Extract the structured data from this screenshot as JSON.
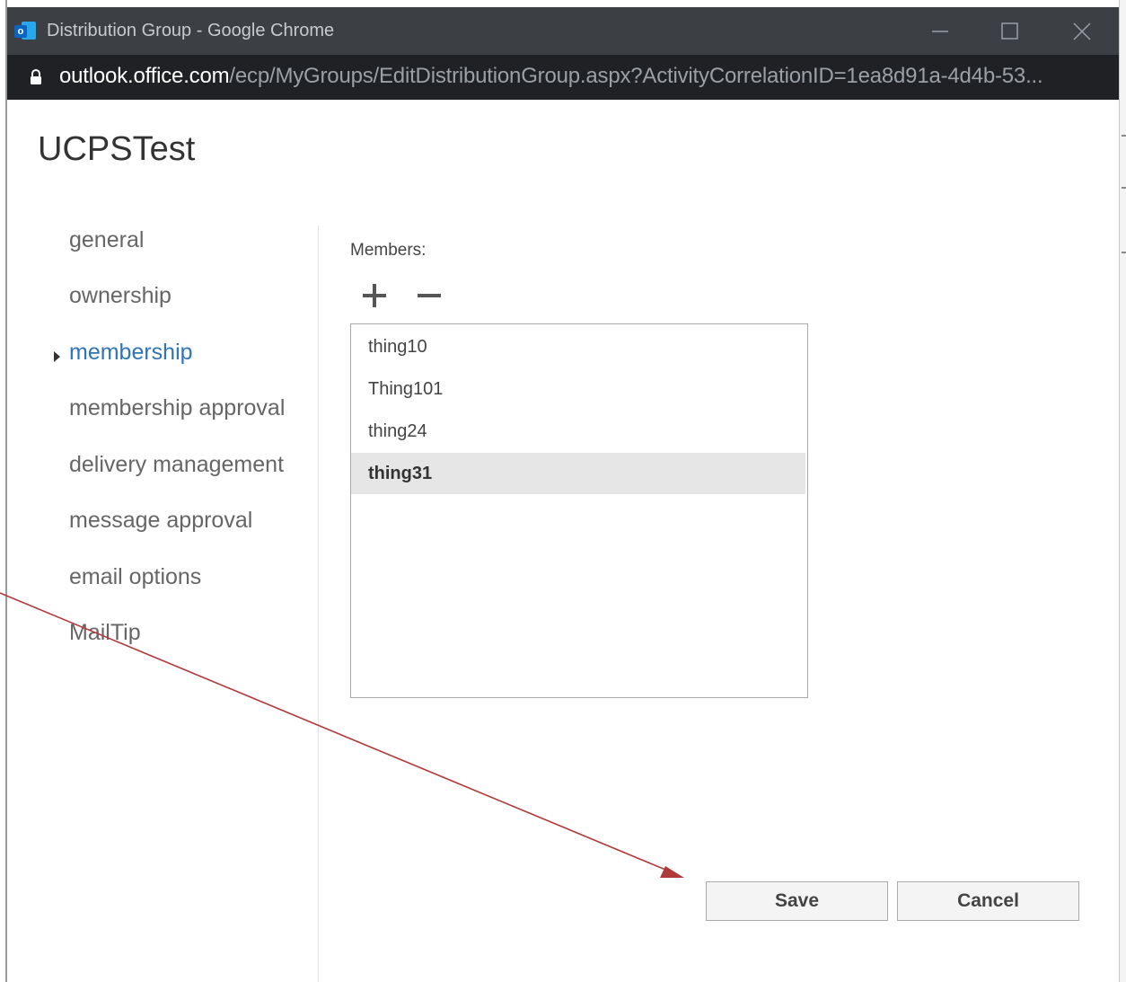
{
  "window": {
    "title": "Distribution Group - Google Chrome",
    "url_host": "outlook.office.com",
    "url_path": "/ecp/MyGroups/EditDistributionGroup.aspx?ActivityCorrelationID=1ea8d91a-4d4b-53..."
  },
  "page": {
    "title": "UCPSTest"
  },
  "nav": {
    "items": [
      {
        "label": "general"
      },
      {
        "label": "ownership"
      },
      {
        "label": "membership"
      },
      {
        "label": "membership approval"
      },
      {
        "label": "delivery management"
      },
      {
        "label": "message approval"
      },
      {
        "label": "email options"
      },
      {
        "label": "MailTip"
      }
    ],
    "selected": "membership"
  },
  "members": {
    "label": "Members:",
    "add_icon": "plus-icon",
    "remove_icon": "minus-icon",
    "list": [
      {
        "name": "thing10"
      },
      {
        "name": "Thing101"
      },
      {
        "name": "thing24"
      },
      {
        "name": "thing31"
      }
    ],
    "selected": "thing31"
  },
  "actions": {
    "save_label": "Save",
    "cancel_label": "Cancel"
  },
  "colors": {
    "titlebar": "#3c3f43",
    "addressbar": "#202124",
    "nav_selected": "#2e75b6",
    "annotation_arrow": "#b03a3a"
  }
}
